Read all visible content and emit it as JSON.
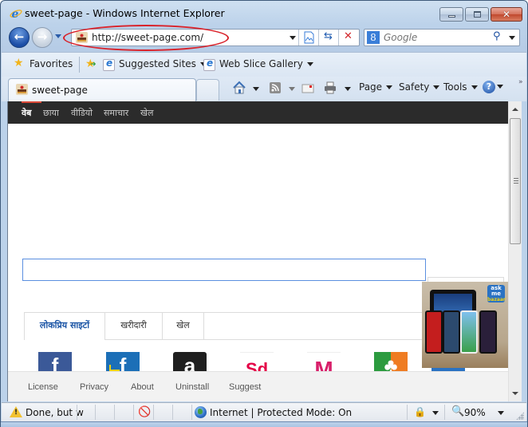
{
  "window": {
    "title": "sweet-page - Windows Internet Explorer"
  },
  "nav": {
    "address": "http://sweet-page.com/",
    "search_placeholder": "Google",
    "search_provider": "8"
  },
  "favorites_bar": {
    "favorites_label": "Favorites",
    "items": [
      {
        "label": "Suggested Sites",
        "icon": "ie-page-icon"
      },
      {
        "label": "Web Slice Gallery",
        "icon": "ie-page-icon"
      }
    ]
  },
  "tabs": [
    {
      "label": "sweet-page",
      "active": true
    }
  ],
  "command_bar": {
    "page_label": "Page",
    "safety_label": "Safety",
    "tools_label": "Tools",
    "help_glyph": "?",
    "overflow_glyph": "»"
  },
  "page": {
    "top_nav": [
      {
        "label": "वेब",
        "active": true
      },
      {
        "label": "छाया",
        "active": false
      },
      {
        "label": "वीडियो",
        "active": false
      },
      {
        "label": "समाचार",
        "active": false
      },
      {
        "label": "खेल",
        "active": false
      }
    ],
    "search_value": "",
    "category_tabs": [
      {
        "label": "लोकप्रिय साइटों",
        "active": true
      },
      {
        "label": "खरीदारी",
        "active": false
      },
      {
        "label": "खेल",
        "active": false
      }
    ],
    "site_tiles": [
      {
        "name": "Facebook",
        "glyph": "f",
        "color": "#3b5998"
      },
      {
        "name": "Flipkart",
        "glyph": "f",
        "color": "#1c6fb7"
      },
      {
        "name": "Amazon",
        "glyph": "a",
        "color": "#1f1f1f"
      },
      {
        "name": "Snapdeal",
        "glyph": "Sd",
        "color": "#e40046"
      },
      {
        "name": "Myntra",
        "glyph": "M",
        "color": "#d81f6a"
      },
      {
        "name": "Quikr",
        "glyph": "♣",
        "color": "#ef7c22"
      }
    ],
    "ad": {
      "brand_lines": [
        "ask",
        "me",
        "bazaar"
      ]
    },
    "footer_links": [
      "License",
      "Privacy",
      "About",
      "Uninstall",
      "Suggest"
    ]
  },
  "status_bar": {
    "status_text": "Done, but w",
    "zone_text": "Internet | Protected Mode: On",
    "zoom_level": "90%"
  },
  "colors": {
    "accent_blue": "#1a54a5",
    "topbar_bg": "#2b2b2b",
    "annotation_red": "#d9222a",
    "search_border": "#5b8fe0"
  }
}
